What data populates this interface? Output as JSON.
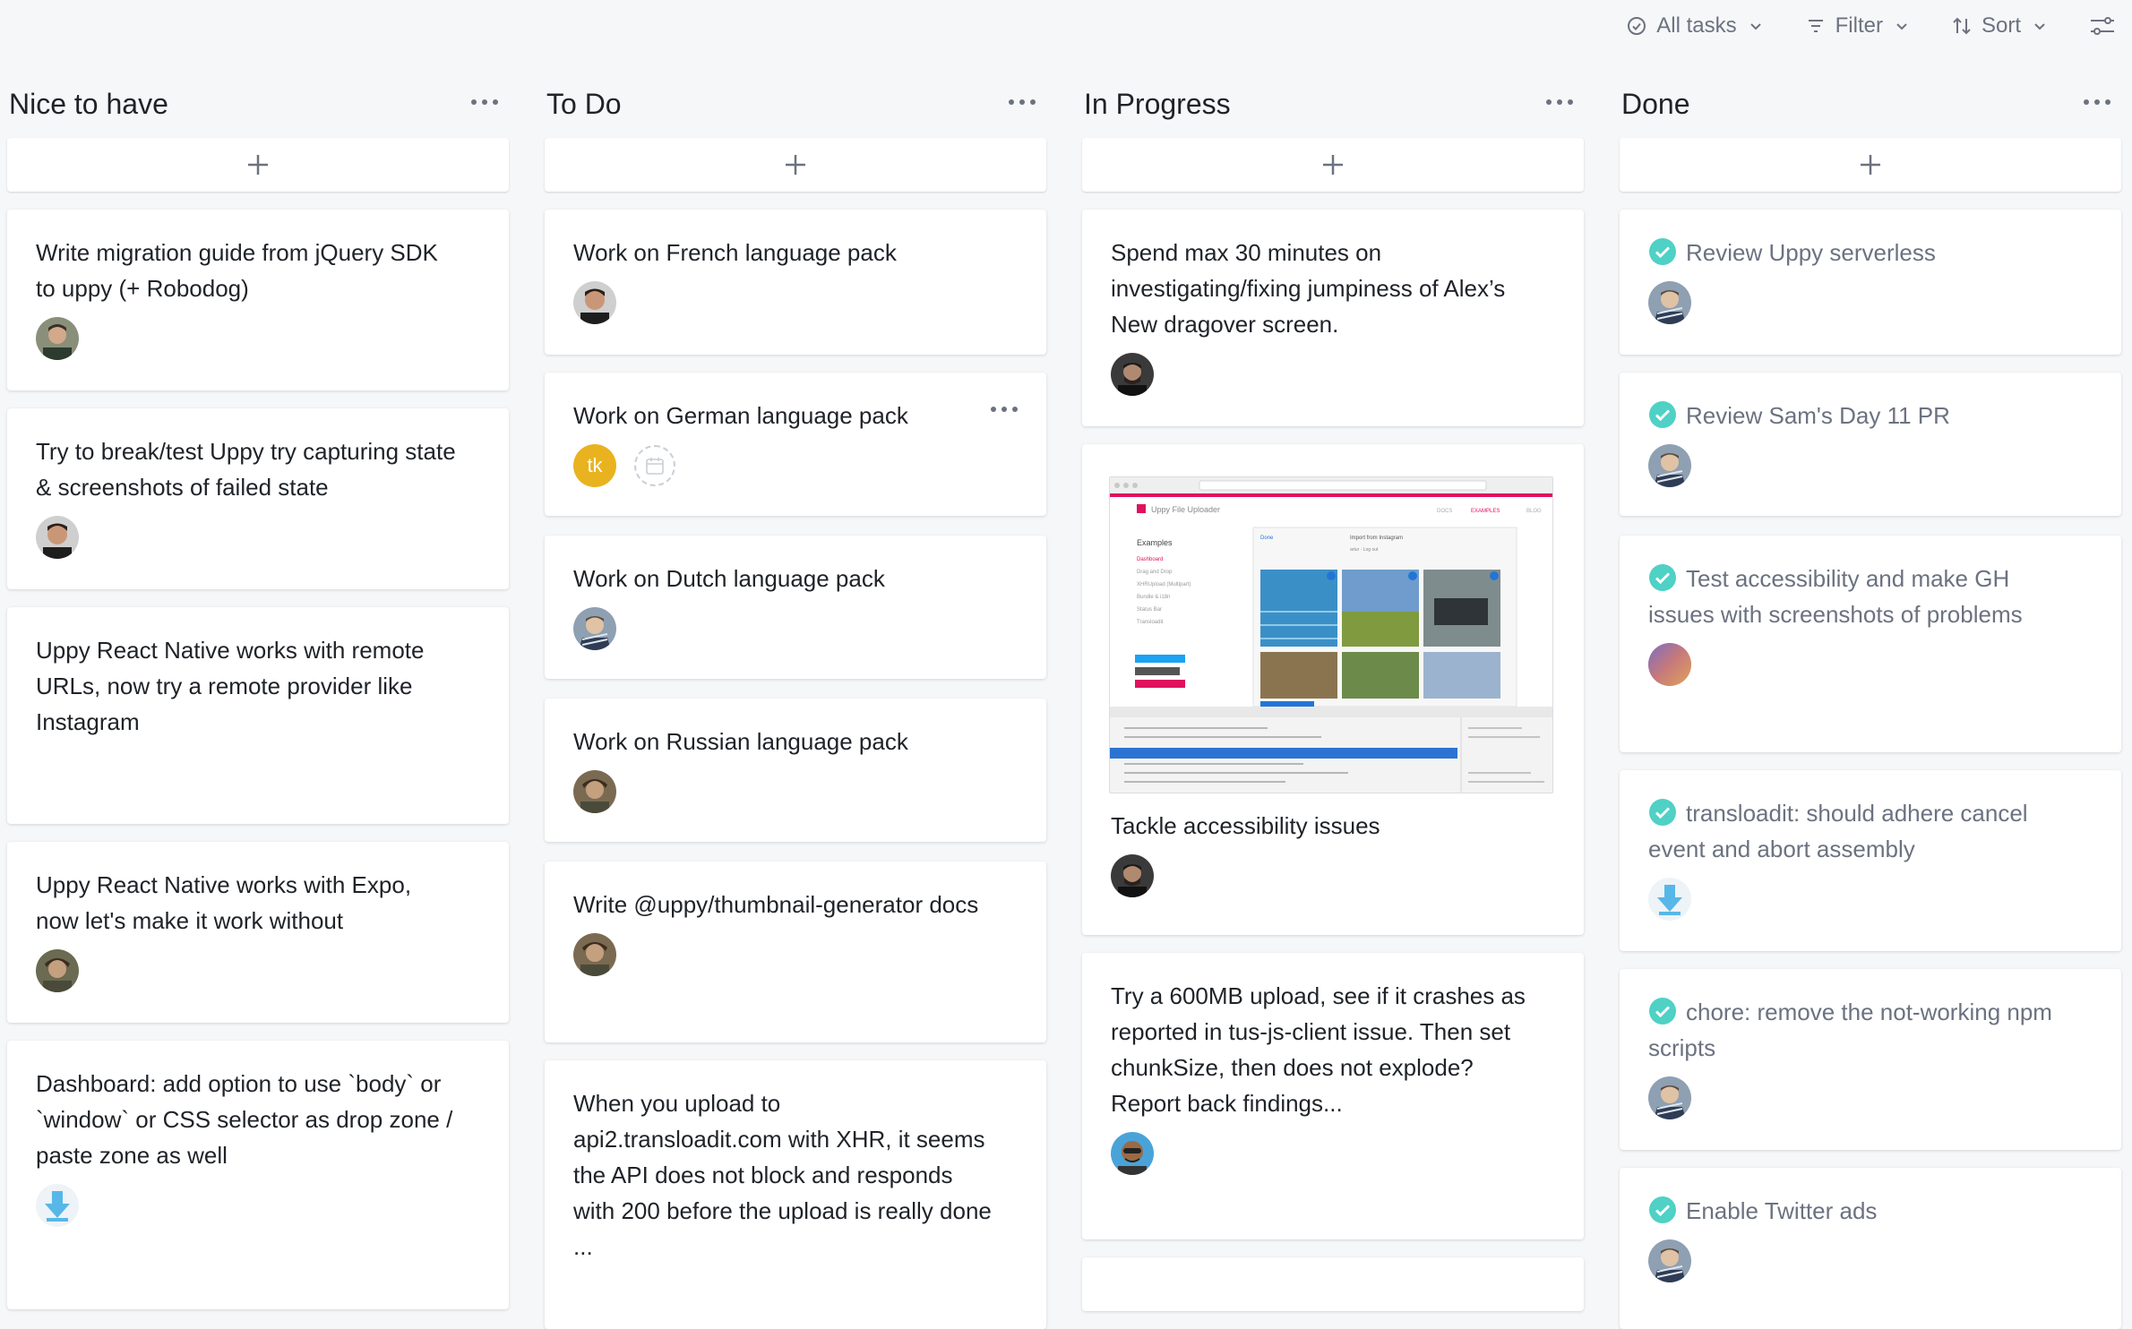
{
  "toolbar": {
    "all_tasks_label": "All tasks",
    "filter_label": "Filter",
    "sort_label": "Sort"
  },
  "columns": [
    {
      "title": "Nice to have",
      "cards": [
        {
          "title": "Write migration guide from jQuery SDK to uppy (+ Robodog)"
        },
        {
          "title": "Try to break/test Uppy try capturing state & screenshots of failed state"
        },
        {
          "title": "Uppy React Native works with remote URLs, now try a remote provider like Instagram"
        },
        {
          "title": "Uppy React Native works with Expo, now let's make it work without"
        },
        {
          "title": "Dashboard: add option to use `body` or `window` or CSS selector as drop zone / paste zone as well"
        }
      ]
    },
    {
      "title": "To Do",
      "cards": [
        {
          "title": "Work on French language pack"
        },
        {
          "title": "Work on German language pack",
          "assignee_initials": "tk"
        },
        {
          "title": "Work on Dutch language pack"
        },
        {
          "title": "Work on Russian language pack"
        },
        {
          "title": "Write @uppy/thumbnail-generator docs"
        },
        {
          "title": "When you upload to api2.transloadit.com with XHR, it seems the API does not block and responds with 200 before the upload is really done ..."
        }
      ]
    },
    {
      "title": "In Progress",
      "cards": [
        {
          "title": "Spend max 30 minutes on investigating/fixing jumpiness of Alex’s New dragover screen."
        },
        {
          "title": "Tackle accessibility issues"
        },
        {
          "title": "Try a 600MB upload, see if it crashes as reported in tus-js-client issue. Then set chunkSize, then does not explode? Report back findings..."
        }
      ]
    },
    {
      "title": "Done",
      "cards": [
        {
          "title": "Review Uppy serverless"
        },
        {
          "title": "Review Sam's Day 11 PR"
        },
        {
          "title": "Test accessibility and make GH issues with screenshots of problems"
        },
        {
          "title": "transloadit: should adhere cancel event and abort assembly"
        },
        {
          "title": "chore: remove the not-working npm scripts"
        },
        {
          "title": "Enable Twitter ads"
        }
      ]
    }
  ],
  "screenshot": {
    "app_title": "Uppy File Uploader",
    "nav": [
      "DOCS",
      "EXAMPLES",
      "BLOG"
    ],
    "sidebar_heading": "Examples",
    "sidebar_items": [
      "Dashboard",
      "Drag and Drop",
      "XHRUpload (Multipart)",
      "Bundle & i18n",
      "Status Bar",
      "Transloadit"
    ],
    "panel_done": "Done",
    "panel_title": "Import from Instagram",
    "panel_sub": "artur · Log out"
  },
  "colors": {
    "check": "#4fd1c5",
    "tk_avatar": "#e9b320",
    "accent_pink": "#e0115f"
  }
}
